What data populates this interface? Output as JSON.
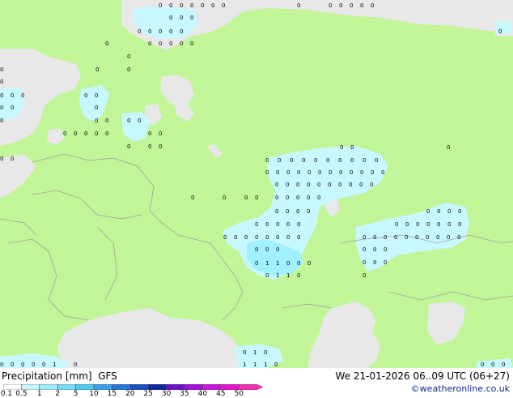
{
  "footer": {
    "legend_title": "Precipitation [mm]  GFS",
    "run_info": "We 21-01-2026 06..09 UTC (06+27)",
    "credit": "©weatheronline.co.uk"
  },
  "legend": {
    "ticks": [
      "0.1",
      "0.5",
      "1",
      "2",
      "5",
      "10",
      "15",
      "20",
      "25",
      "30",
      "35",
      "40",
      "45",
      "50"
    ],
    "colors": [
      "#ffffff",
      "#c6f6ff",
      "#a0ecff",
      "#78dcf8",
      "#50c8f0",
      "#3aa0e8",
      "#2878d8",
      "#1e4ec4",
      "#14289c",
      "#6c10c8",
      "#a010d8",
      "#cc14dc",
      "#e614d0",
      "#f032b4"
    ]
  },
  "map": {
    "land_color": "#c2f598",
    "sea_color": "#e8e8e8",
    "light_precip_color": "#c8f8ff",
    "medium_precip_color": "#a0f0ff",
    "border_color": "#a0a0a0"
  },
  "station_labels": {
    "c1": "0",
    "c2": "1",
    "v1": "0",
    "v2": "0",
    "v3": "0",
    "v4": "0",
    "v5": "0",
    "v6": "1",
    "v7": "1",
    "v8": "0",
    "v9": "0",
    "v10": "0",
    "v11": "1",
    "v12": "1",
    "v13": "0",
    "v14": "0",
    "v15": "1",
    "v16": "1",
    "v17": "0",
    "v18": "0"
  }
}
